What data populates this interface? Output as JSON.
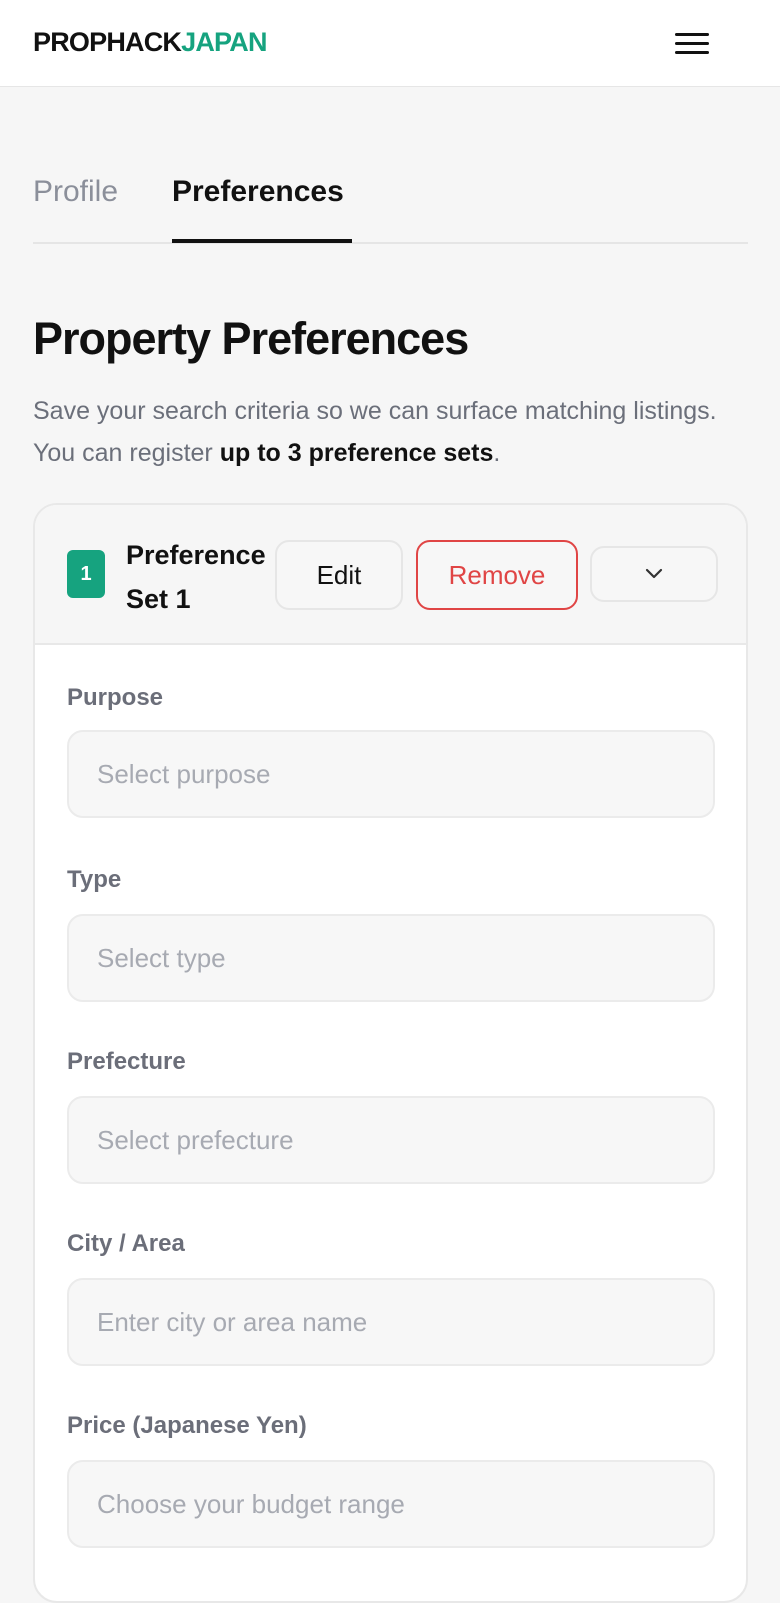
{
  "header": {
    "logo_part1": "PROPHACK",
    "logo_part2": "JAPAN",
    "menu_icon": "hamburger-menu-icon"
  },
  "tabs": [
    {
      "label": "Profile",
      "active": false
    },
    {
      "label": "Preferences",
      "active": true
    }
  ],
  "page": {
    "title": "Property Preferences",
    "intro_text": "Save your search criteria so we can surface matching listings. You can register ",
    "intro_bold": "up to 3 preference sets",
    "intro_end": "."
  },
  "preference_set": {
    "number": "1",
    "title": "Preference Set 1",
    "edit_label": "Edit",
    "remove_label": "Remove",
    "toggle_icon": "chevron-down-icon",
    "fields": [
      {
        "label": "Purpose",
        "placeholder": "Select purpose"
      },
      {
        "label": "Type",
        "placeholder": "Select type"
      },
      {
        "label": "Prefecture",
        "placeholder": "Select prefecture"
      },
      {
        "label": "City / Area",
        "placeholder": "Enter city or area name"
      },
      {
        "label": "Price (Japanese Yen)",
        "placeholder": "Choose your budget range"
      }
    ]
  },
  "colors": {
    "accent": "#16a37f",
    "danger": "#e04545",
    "text": "#111111",
    "muted": "#6b6f7a"
  }
}
